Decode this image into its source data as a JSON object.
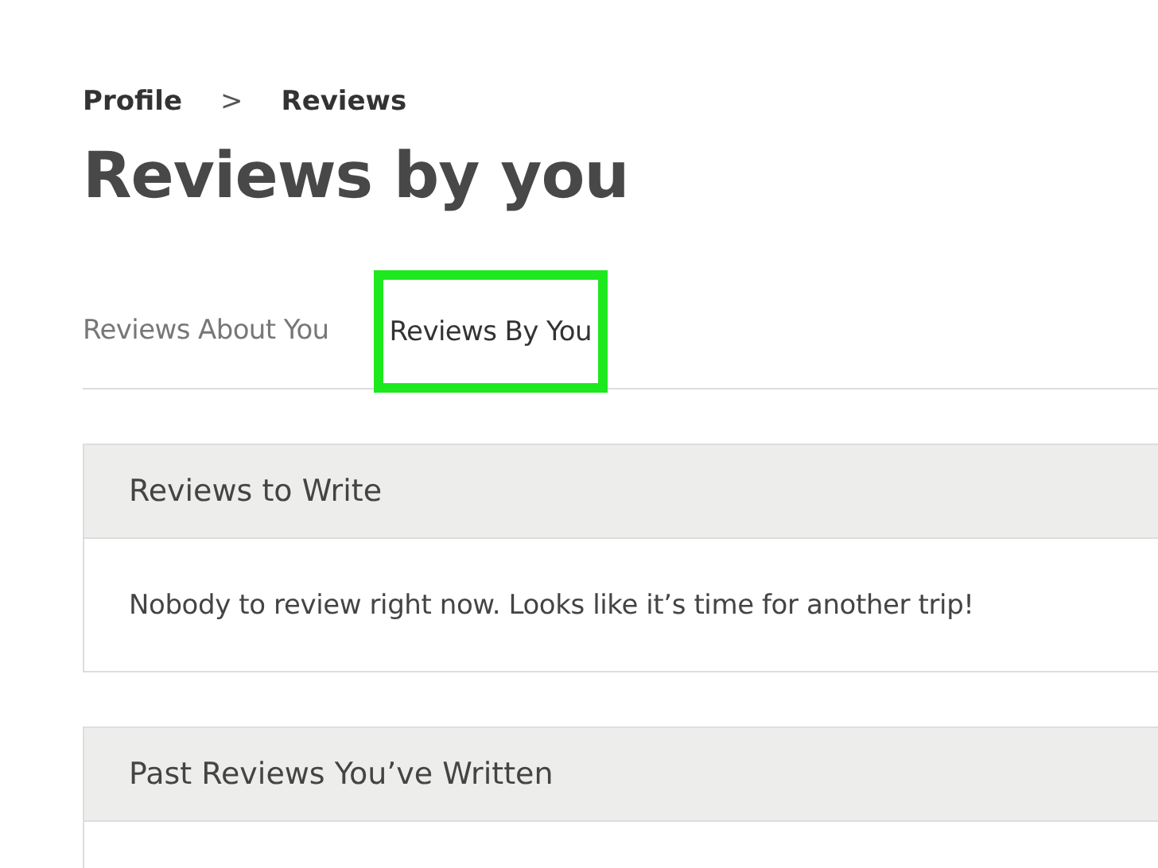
{
  "breadcrumb": [
    {
      "label": "Profile"
    },
    {
      "label": ">"
    },
    {
      "label": "Reviews"
    }
  ],
  "title": "Reviews by you",
  "tabs": [
    {
      "label": "Reviews About You",
      "selected": false
    },
    {
      "label": "Reviews By You",
      "selected": true
    }
  ],
  "sections": [
    {
      "heading": "Reviews to Write",
      "body": "Nobody to review right now. Looks like it’s time for another trip!"
    },
    {
      "heading": "Past Reviews You’ve Written"
    }
  ]
}
